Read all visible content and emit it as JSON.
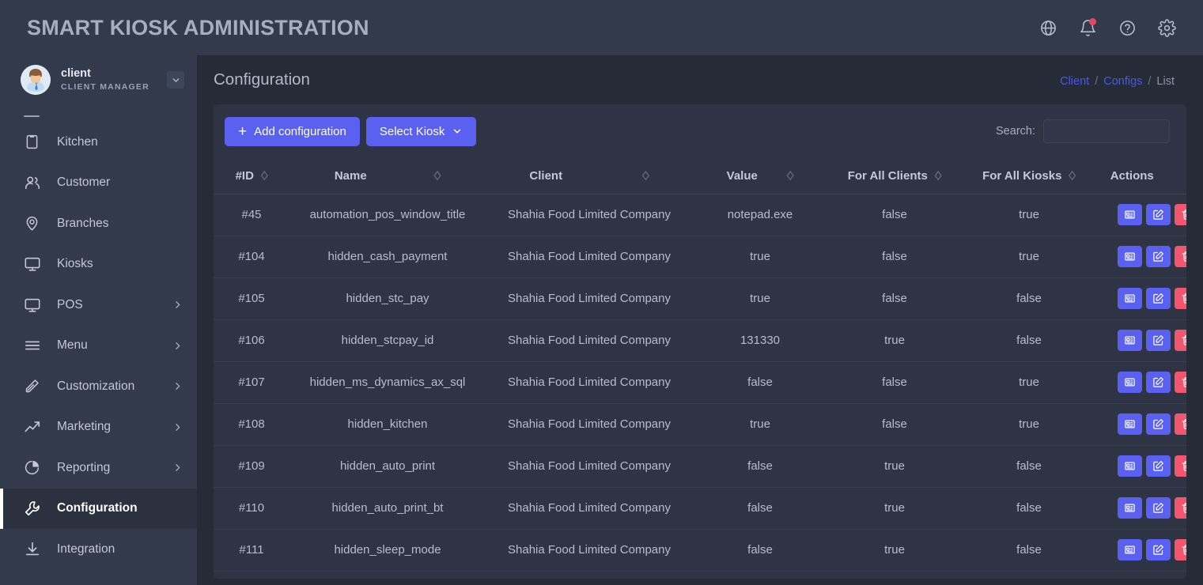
{
  "header": {
    "app_title": "SMART KIOSK ADMINISTRATION",
    "icons": [
      {
        "name": "globe-icon",
        "label": "Language"
      },
      {
        "name": "bell-icon",
        "label": "Notifications"
      },
      {
        "name": "help-circle-icon",
        "label": "Help"
      },
      {
        "name": "gear-icon",
        "label": "Settings"
      }
    ]
  },
  "sidebar": {
    "profile": {
      "name": "client",
      "role": "CLIENT MANAGER",
      "caret": "chevron-down-icon"
    },
    "items": [
      {
        "label": "Kitchen",
        "icon": "clipboard-icon",
        "has_submenu": false,
        "active": false
      },
      {
        "label": "Customer",
        "icon": "users-icon",
        "has_submenu": false,
        "active": false
      },
      {
        "label": "Branches",
        "icon": "map-pin-icon",
        "has_submenu": false,
        "active": false
      },
      {
        "label": "Kiosks",
        "icon": "monitor-icon",
        "has_submenu": false,
        "active": false
      },
      {
        "label": "POS",
        "icon": "monitor-icon",
        "has_submenu": true,
        "active": false
      },
      {
        "label": "Menu",
        "icon": "list-icon",
        "has_submenu": true,
        "active": false
      },
      {
        "label": "Customization",
        "icon": "pencil-icon",
        "has_submenu": true,
        "active": false
      },
      {
        "label": "Marketing",
        "icon": "trend-up-icon",
        "has_submenu": true,
        "active": false
      },
      {
        "label": "Reporting",
        "icon": "pie-chart-icon",
        "has_submenu": true,
        "active": false
      },
      {
        "label": "Configuration",
        "icon": "wrench-icon",
        "has_submenu": false,
        "active": true
      },
      {
        "label": "Integration",
        "icon": "download-icon",
        "has_submenu": false,
        "active": false
      }
    ]
  },
  "page": {
    "title": "Configuration",
    "breadcrumb": {
      "items": [
        "Client",
        "Configs",
        "List"
      ],
      "separator": "/"
    }
  },
  "toolbar": {
    "add_label": "Add configuration",
    "add_plus": "+",
    "kiosk_label": "Select Kiosk",
    "search_label": "Search:",
    "search_value": "",
    "search_placeholder": ""
  },
  "table": {
    "columns": [
      {
        "key": "id",
        "label": "#ID",
        "sortable": true
      },
      {
        "key": "name",
        "label": "Name",
        "sortable": true
      },
      {
        "key": "client",
        "label": "Client",
        "sortable": true
      },
      {
        "key": "value",
        "label": "Value",
        "sortable": true
      },
      {
        "key": "fac",
        "label": "For All Clients",
        "sortable": true
      },
      {
        "key": "fak",
        "label": "For All Kiosks",
        "sortable": true
      },
      {
        "key": "actions",
        "label": "Actions",
        "sortable": true
      }
    ],
    "rows": [
      {
        "id": "#45",
        "name": "automation_pos_window_title",
        "client": "Shahia Food Limited Company",
        "value": "notepad.exe",
        "fac": "false",
        "fak": "true"
      },
      {
        "id": "#104",
        "name": "hidden_cash_payment",
        "client": "Shahia Food Limited Company",
        "value": "true",
        "fac": "false",
        "fak": "true"
      },
      {
        "id": "#105",
        "name": "hidden_stc_pay",
        "client": "Shahia Food Limited Company",
        "value": "true",
        "fac": "false",
        "fak": "false"
      },
      {
        "id": "#106",
        "name": "hidden_stcpay_id",
        "client": "Shahia Food Limited Company",
        "value": "131330",
        "fac": "true",
        "fak": "false"
      },
      {
        "id": "#107",
        "name": "hidden_ms_dynamics_ax_sql",
        "client": "Shahia Food Limited Company",
        "value": "false",
        "fac": "false",
        "fak": "true"
      },
      {
        "id": "#108",
        "name": "hidden_kitchen",
        "client": "Shahia Food Limited Company",
        "value": "true",
        "fac": "false",
        "fak": "true"
      },
      {
        "id": "#109",
        "name": "hidden_auto_print",
        "client": "Shahia Food Limited Company",
        "value": "false",
        "fac": "true",
        "fak": "false"
      },
      {
        "id": "#110",
        "name": "hidden_auto_print_bt",
        "client": "Shahia Food Limited Company",
        "value": "false",
        "fac": "true",
        "fak": "false"
      },
      {
        "id": "#111",
        "name": "hidden_sleep_mode",
        "client": "Shahia Food Limited Company",
        "value": "false",
        "fac": "true",
        "fak": "false"
      }
    ],
    "row_actions": [
      {
        "name": "view-details-button",
        "icon": "article-icon",
        "style": "blue"
      },
      {
        "name": "edit-button",
        "icon": "edit-square-icon",
        "style": "blue"
      },
      {
        "name": "delete-button",
        "icon": "trash-icon",
        "style": "red"
      }
    ],
    "sort_icon": "◇"
  },
  "colors": {
    "accent": "#5a60f0",
    "danger": "#f2566e",
    "link": "#4c56e8",
    "topbar_bg": "#333a4b",
    "sidebar_bg": "#333a4b",
    "content_bg": "#262b38",
    "card_bg": "#2e3444",
    "active_nav_bg": "#2b313f"
  }
}
